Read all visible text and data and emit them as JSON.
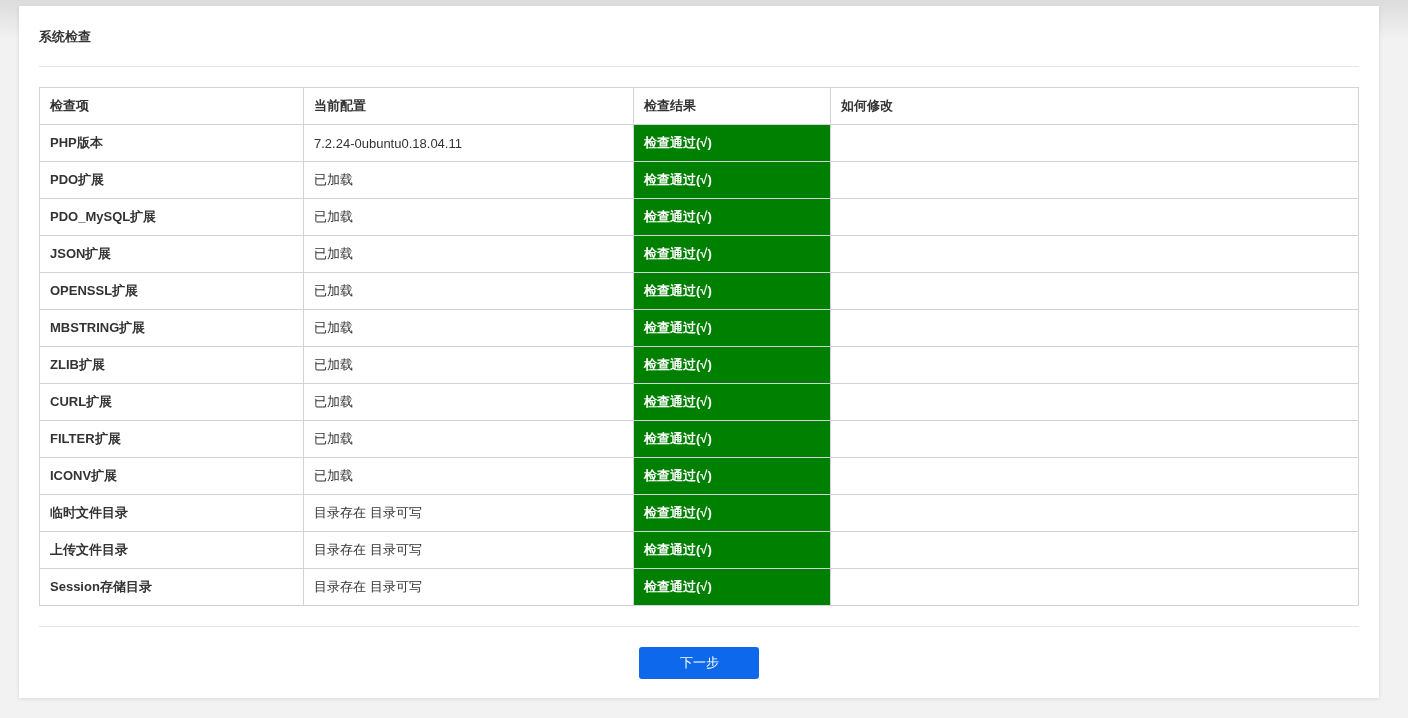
{
  "title": "系统检查",
  "table": {
    "columns": [
      "检查项",
      "当前配置",
      "检查结果",
      "如何修改"
    ],
    "rows": [
      {
        "item": "PHP版本",
        "config": "7.2.24-0ubuntu0.18.04.11",
        "result": "检查通过(√)",
        "passed": true
      },
      {
        "item": "PDO扩展",
        "config": "已加载",
        "result": "检查通过(√)",
        "passed": true
      },
      {
        "item": "PDO_MySQL扩展",
        "config": "已加载",
        "result": "检查通过(√)",
        "passed": true
      },
      {
        "item": "JSON扩展",
        "config": "已加载",
        "result": "检查通过(√)",
        "passed": true
      },
      {
        "item": "OPENSSL扩展",
        "config": "已加载",
        "result": "检查通过(√)",
        "passed": true
      },
      {
        "item": "MBSTRING扩展",
        "config": "已加载",
        "result": "检查通过(√)",
        "passed": true
      },
      {
        "item": "ZLIB扩展",
        "config": "已加载",
        "result": "检查通过(√)",
        "passed": true
      },
      {
        "item": "CURL扩展",
        "config": "已加载",
        "result": "检查通过(√)",
        "passed": true
      },
      {
        "item": "FILTER扩展",
        "config": "已加载",
        "result": "检查通过(√)",
        "passed": true
      },
      {
        "item": "ICONV扩展",
        "config": "已加载",
        "result": "检查通过(√)",
        "passed": true
      },
      {
        "item": "临时文件目录",
        "config": "目录存在 目录可写",
        "result": "检查通过(√)",
        "passed": true
      },
      {
        "item": "上传文件目录",
        "config": "目录存在 目录可写",
        "result": "检查通过(√)",
        "passed": true
      },
      {
        "item": "Session存储目录",
        "config": "目录存在 目录可写",
        "result": "检查通过(√)",
        "passed": true
      }
    ]
  },
  "next_button": "下一步"
}
